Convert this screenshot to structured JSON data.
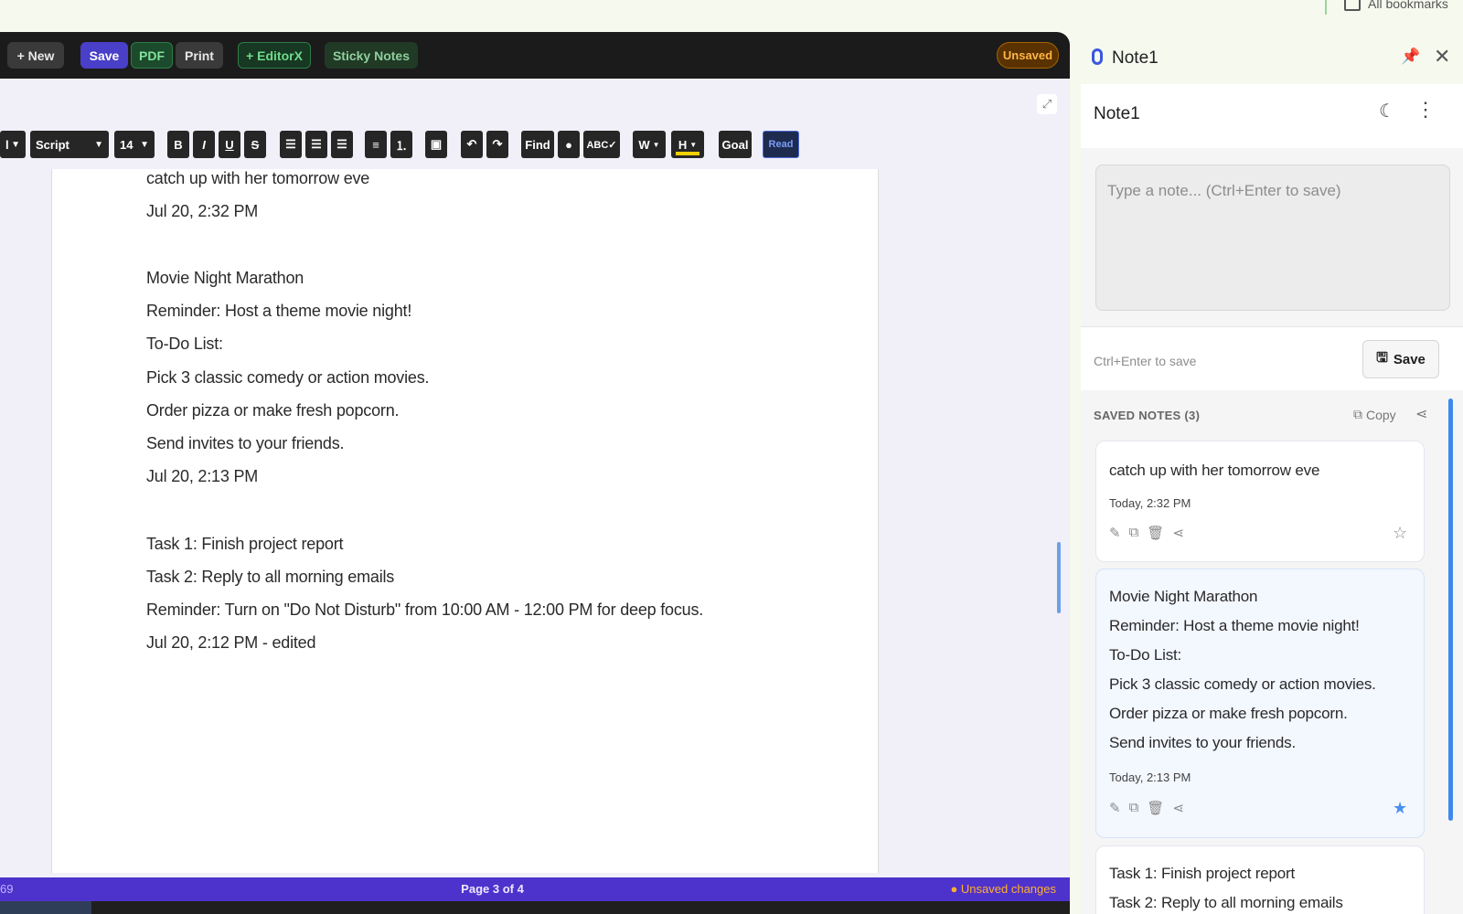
{
  "browser": {
    "bookmarks_label": "All bookmarks"
  },
  "toolbar": {
    "new_label": "+ New",
    "save_label": "Save",
    "pdf_label": "PDF",
    "print_label": "Print",
    "editorx_label": "+ EditorX",
    "sticky_label": "Sticky Notes",
    "unsaved_label": "Unsaved"
  },
  "format_bar": {
    "partial_select": "l",
    "font": "Script",
    "size": "14",
    "bold": "B",
    "italic": "I",
    "underline": "U",
    "strike": "S",
    "find": "Find",
    "spell": "ABC✓",
    "word_color": "W",
    "highlight": "H",
    "goal": "Goal",
    "read": "Read"
  },
  "document": {
    "lines": [
      "catch up with her tomorrow eve",
      "Jul 20, 2:32 PM",
      "Movie Night Marathon",
      "Reminder: Host a theme movie night!",
      "To-Do List:",
      "Pick 3 classic comedy or action movies.",
      "Order pizza or make fresh popcorn.",
      "Send invites to your friends.",
      "Jul 20, 2:13 PM",
      "Task 1: Finish project report",
      "Task 2: Reply to all morning emails",
      "Reminder: Turn on \"Do Not Disturb\" from 10:00 AM - 12:00 PM for deep focus.",
      "Jul 20, 2:12 PM - edited"
    ]
  },
  "status": {
    "left": "69",
    "page": "Page 3 of 4",
    "changes": "● Unsaved changes"
  },
  "panel": {
    "title": "Note1",
    "card_title": "Note1",
    "input_placeholder": "Type a note... (Ctrl+Enter to save)",
    "save_hint": "Ctrl+Enter to save",
    "save_label": "Save",
    "saved_header": "SAVED NOTES (3)",
    "copy_label": "Copy",
    "notes": [
      {
        "lines": [
          "catch up with her tomorrow eve"
        ],
        "time": "Today, 2:32 PM",
        "starred": false
      },
      {
        "lines": [
          "Movie Night Marathon",
          "Reminder: Host a theme movie night!",
          "To-Do List:",
          "Pick 3 classic comedy or action movies.",
          "Order pizza or make fresh popcorn.",
          "Send invites to your friends."
        ],
        "time": "Today, 2:13 PM",
        "starred": true
      },
      {
        "lines": [
          "Task 1: Finish project report",
          "Task 2: Reply to all morning emails"
        ],
        "time": "",
        "starred": false
      }
    ]
  },
  "colors": {
    "topbar_bg": "#1b1b1b",
    "save_accent": "#4a3fc8",
    "statusbar_bg": "#4e32cc",
    "unsaved_orange": "#ffb547",
    "star_blue": "#4a90f0"
  },
  "icons": {
    "expand": "expand-icon",
    "pin": "pin-icon",
    "close": "close-icon",
    "moon": "moon-icon",
    "kebab": "kebab-menu-icon",
    "save": "floppy-icon",
    "copy": "copy-icon",
    "share": "share-icon",
    "edit": "edit-icon",
    "duplicate": "duplicate-icon",
    "trash": "trash-icon",
    "star": "star-icon"
  }
}
